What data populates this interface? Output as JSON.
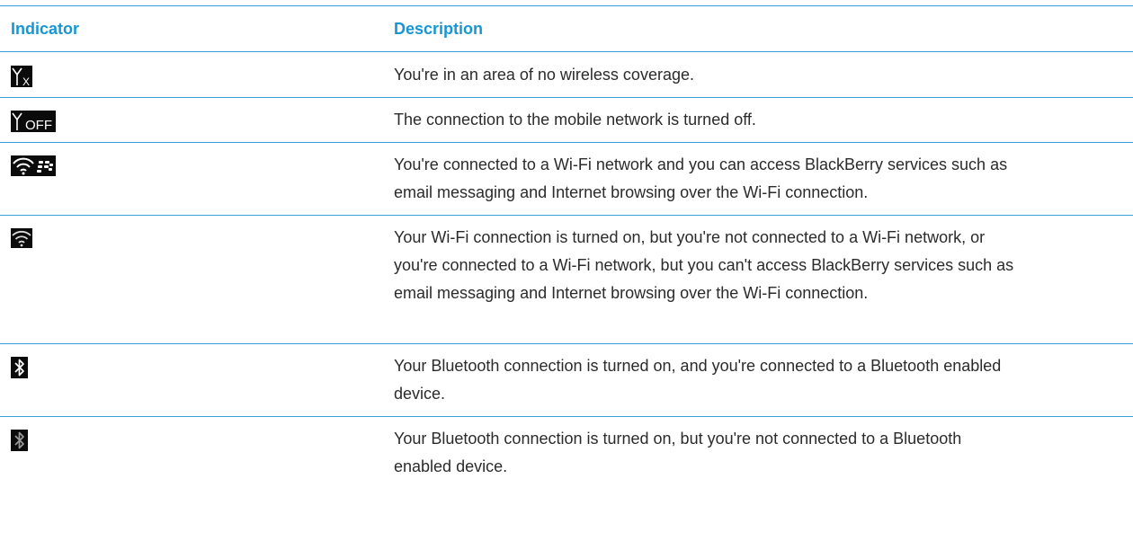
{
  "table": {
    "headers": {
      "indicator": "Indicator",
      "description": "Description"
    },
    "rows": [
      {
        "icon": "no-coverage-icon",
        "icon_text": "X",
        "description": "You're in an area of no wireless coverage."
      },
      {
        "icon": "network-off-icon",
        "icon_text": "OFF",
        "description": "The connection to the mobile network is turned off."
      },
      {
        "icon": "wifi-blackberry-services-icon",
        "icon_text": "",
        "description": "You're connected to a Wi-Fi network and you can access BlackBerry services such as email messaging and Internet browsing over the Wi-Fi connection."
      },
      {
        "icon": "wifi-no-services-icon",
        "icon_text": "",
        "description": "Your Wi-Fi connection is turned on, but you're not connected to a Wi-Fi network, or you're connected to a Wi-Fi network, but you can't access BlackBerry services such as email messaging and Internet browsing over the Wi-Fi connection."
      },
      {
        "icon": "bluetooth-connected-icon",
        "icon_text": "",
        "description": "Your Bluetooth connection is turned on, and you're connected to a Bluetooth enabled device."
      },
      {
        "icon": "bluetooth-on-icon",
        "icon_text": "",
        "description": "Your Bluetooth connection is turned on, but you're not connected to a Bluetooth enabled device."
      }
    ]
  },
  "colors": {
    "header_text": "#1696d3",
    "rule": "#3a9fd6",
    "icon_background": "#0b0b0b",
    "icon_glyph": "#ffffff"
  }
}
